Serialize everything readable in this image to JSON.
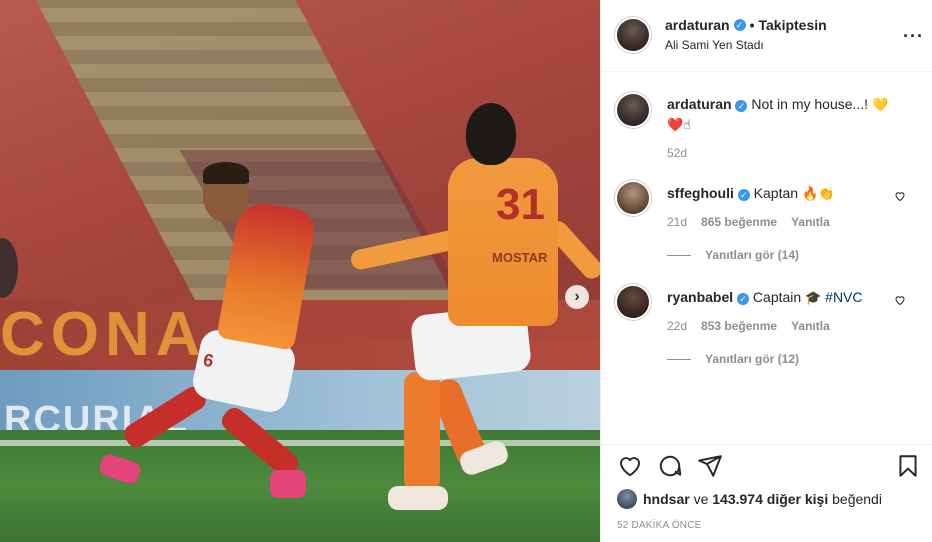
{
  "photo": {
    "ad_text_top": "CONA",
    "ad_text_bottom": "RCURIAL",
    "shirt_number": "31",
    "shirt_name": "MOSTAR",
    "shorts_number": "6",
    "next_icon": "chevron-right-icon"
  },
  "header": {
    "username": "ardaturan",
    "separator": "•",
    "follow_status": "Takiptesin",
    "location": "Ali Sami Yen Stadı",
    "more_icon": "more-horizontal-icon"
  },
  "caption": {
    "username": "ardaturan",
    "text": "Not in my house...!",
    "emojis_line1": "💛",
    "emojis_line2": "❤️☝",
    "age": "52d"
  },
  "comments": [
    {
      "username": "sffeghouli",
      "text": "Kaptan",
      "emojis": "🔥👏",
      "age": "21d",
      "likes": "865 beğenme",
      "reply": "Yanıtla",
      "view_replies": "Yanıtları gör (14)"
    },
    {
      "username": "ryanbabel",
      "text": "Captain",
      "emojis": "🎓",
      "hashtag": "#NVC",
      "age": "22d",
      "likes": "853 beğenme",
      "reply": "Yanıtla",
      "view_replies": "Yanıtları gör (12)"
    }
  ],
  "actions": {
    "like_icon": "heart-icon",
    "comment_icon": "comment-icon",
    "share_icon": "send-icon",
    "save_icon": "bookmark-icon"
  },
  "likes": {
    "first_user": "hndsar",
    "connector": "ve",
    "others": "143.974 diğer kişi",
    "suffix": "beğendi"
  },
  "timestamp": "52 DAKİKA ÖNCE",
  "colors": {
    "verified": "#3897f0",
    "hashtag": "#00376b",
    "meta_gray": "#8e8e8e"
  }
}
